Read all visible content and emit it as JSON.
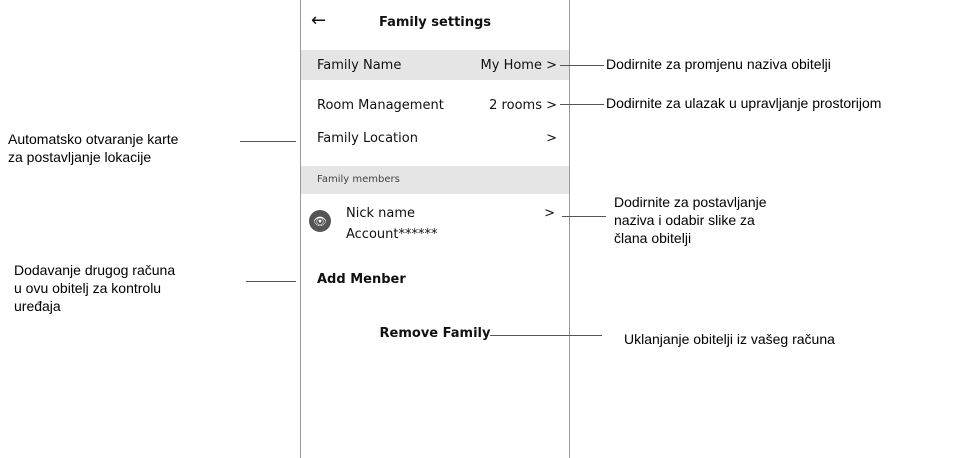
{
  "header": {
    "back_icon": "back-arrow-icon",
    "back_glyph": "←",
    "title": "Family settings"
  },
  "rows": {
    "family_name": {
      "label": "Family Name",
      "value": "My Home >"
    },
    "room_management": {
      "label": "Room Management",
      "value": "2 rooms >"
    },
    "family_location": {
      "label": "Family Location",
      "value": ">"
    }
  },
  "members_section": {
    "title": "Family members",
    "member": {
      "avatar_icon": "avatar-eye-icon",
      "avatar_glyph": "👁",
      "name": "Nick name",
      "account": "Account******",
      "chevron": ">"
    },
    "add_member": "Add Menber"
  },
  "remove_family": "Remove Family",
  "callouts": {
    "family_name": "Dodirnite za promjenu naziva obitelji",
    "room_management": "Dodirnite za ulazak u upravljanje prostorijom",
    "location_1": "Automatsko otvaranje karte",
    "location_2": "za postavljanje lokacije",
    "member_1": "Dodirnite za postavljanje",
    "member_2": "naziva i odabir slike za",
    "member_3": "člana obitelji",
    "add_1": "Dodavanje drugog računa",
    "add_2": "u ovu obitelj za kontrolu",
    "add_3": "uređaja",
    "remove": "Uklanjanje obitelji iz vašeg računa"
  }
}
